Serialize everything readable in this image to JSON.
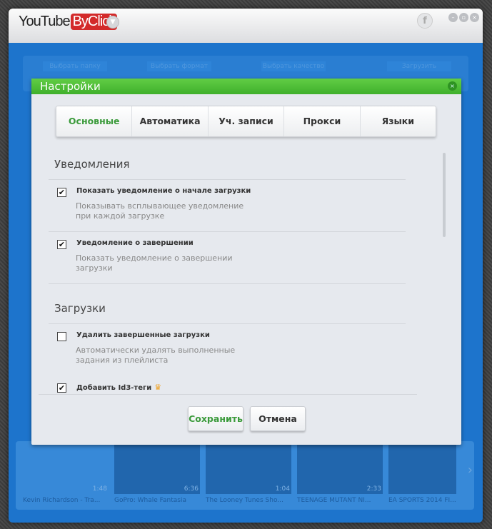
{
  "app": {
    "logo_left": "YouTube",
    "logo_right": "ByClick"
  },
  "steps": [
    "Выбрать папку",
    "Выбрать формат",
    "Выбрать качество",
    "Загрузить"
  ],
  "videos": [
    {
      "title": "Kevin Richardson - Tra...",
      "duration": "1:48"
    },
    {
      "title": "GoPro: Whale Fantasia",
      "duration": "6:36"
    },
    {
      "title": "The Looney Tunes Sho...",
      "duration": "1:04"
    },
    {
      "title": "TEENAGE MUTANT NI...",
      "duration": "2:33"
    },
    {
      "title": "EA SPORTS 2014 FI...",
      "duration": ""
    }
  ],
  "dialog": {
    "title": "Настройки",
    "tabs": [
      "Основные",
      "Автоматика",
      "Уч. записи",
      "Прокси",
      "Языки"
    ],
    "sections": [
      {
        "title": "Уведомления",
        "options": [
          {
            "label": "Показать уведомление о начале загрузки",
            "desc": "Показывать всплывающее уведомление при каждой загрузке",
            "checked": true
          },
          {
            "label": "Уведомление о завершении",
            "desc": "Показать уведомление о завершении загрузки",
            "checked": true
          }
        ]
      },
      {
        "title": "Загрузки",
        "options": [
          {
            "label": "Удалить завершенные загрузки",
            "desc": "Автоматически удалять выполненные задания из плейлиста",
            "checked": false
          },
          {
            "label": "Добавить Id3-теги",
            "desc": "",
            "checked": true
          }
        ]
      }
    ],
    "save": "Сохранить",
    "cancel": "Отмена"
  }
}
